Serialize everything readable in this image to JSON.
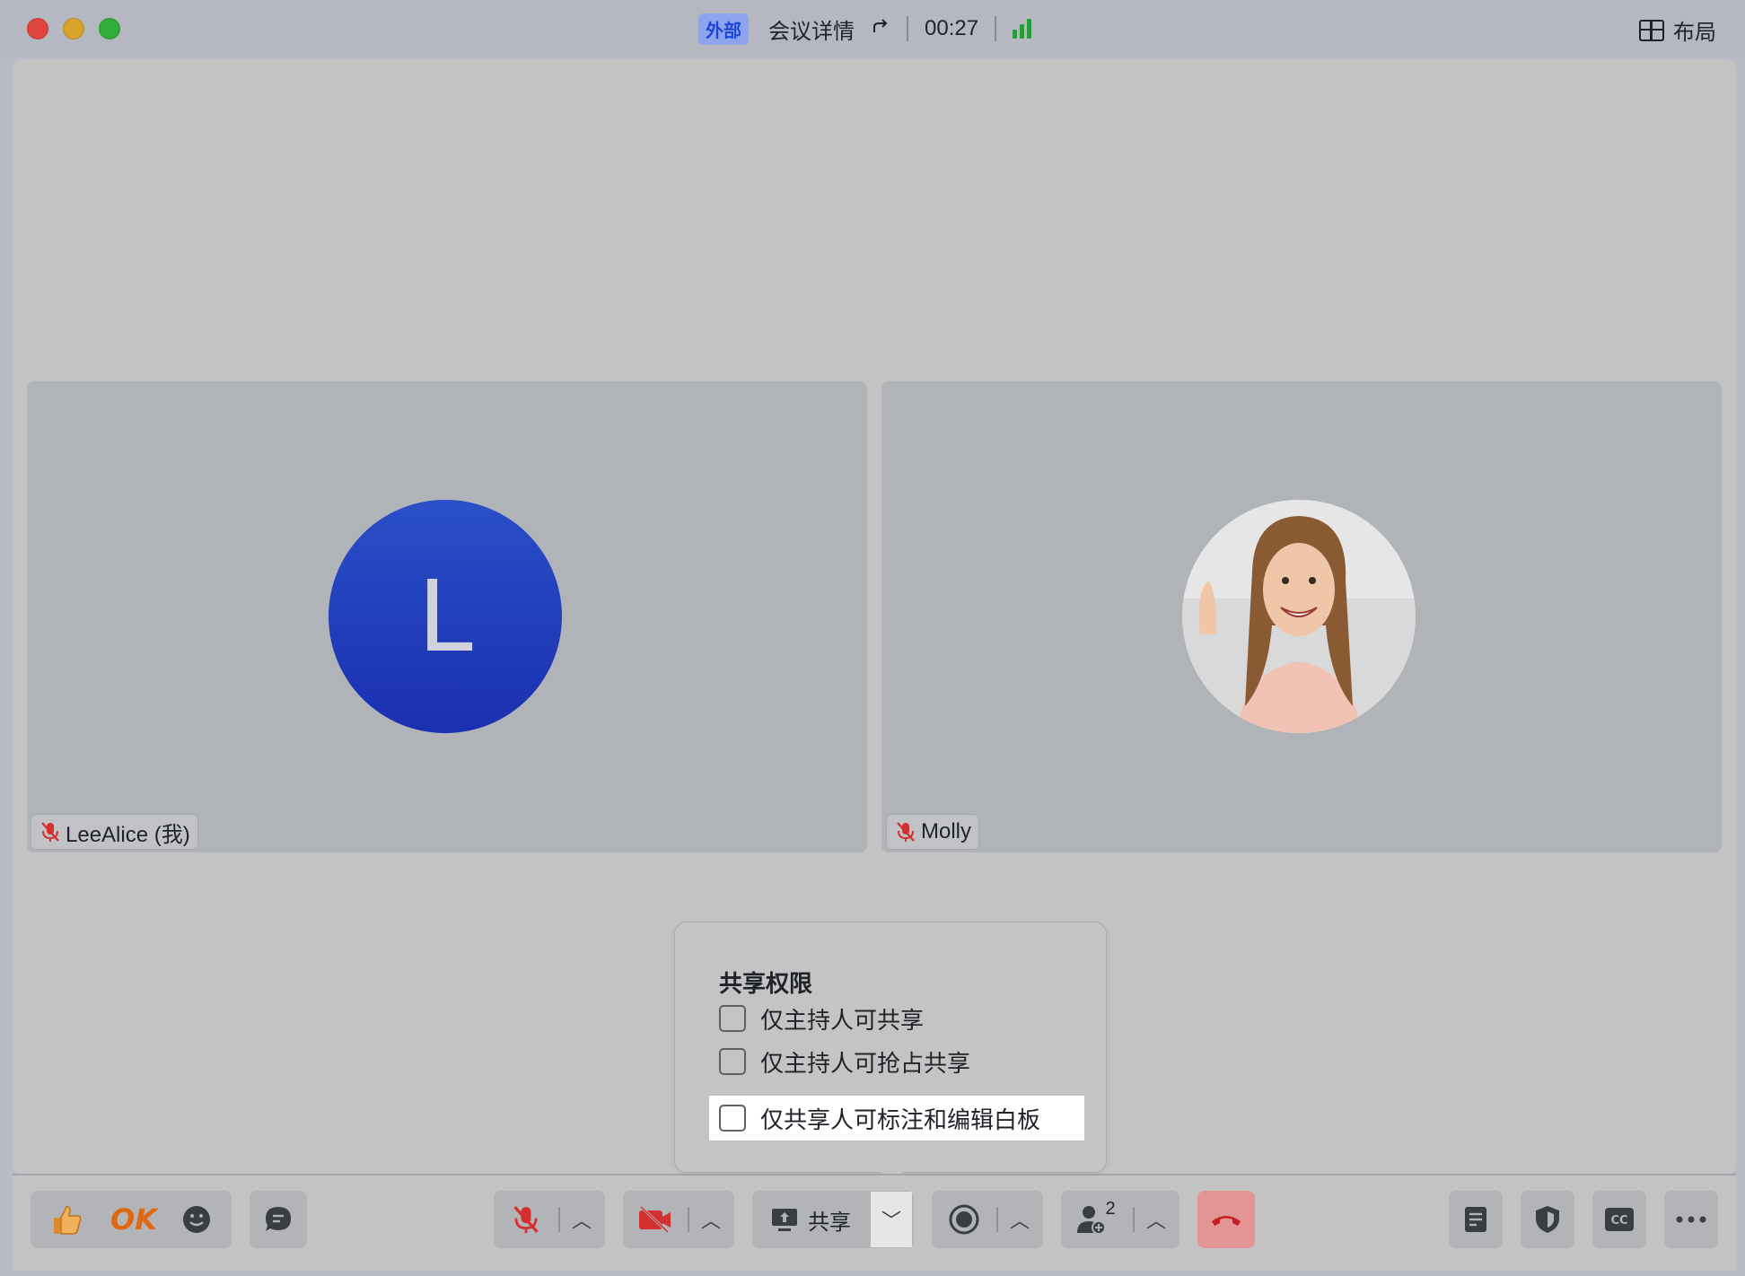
{
  "titlebar": {
    "badge": "外部",
    "meeting_details": "会议详情",
    "timer": "00:27",
    "layout_label": "布局"
  },
  "participants": [
    {
      "name": "LeeAlice (我)",
      "avatar_letter": "L",
      "muted": true
    },
    {
      "name": "Molly",
      "muted": true
    }
  ],
  "popover": {
    "title": "共享权限",
    "options": [
      {
        "label": "仅主持人可共享",
        "checked": false
      },
      {
        "label": "仅主持人可抢占共享",
        "checked": false
      },
      {
        "label": "仅共享人可标注和编辑白板",
        "checked": false,
        "highlighted": true
      }
    ]
  },
  "toolbar": {
    "reaction_ok": "OK",
    "share_label": "共享",
    "participant_count": "2"
  },
  "colors": {
    "accent": "#1a2fb0",
    "end_call": "#e39595",
    "muted_red": "#d43030",
    "signal_green": "#2a9b3b"
  }
}
